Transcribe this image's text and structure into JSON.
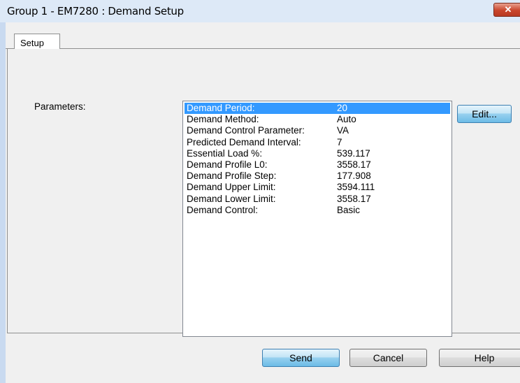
{
  "window": {
    "title": "Group 1 - EM7280 : Demand Setup",
    "close_label": "✕"
  },
  "tabs": [
    {
      "label": "Setup"
    }
  ],
  "parameters": {
    "label": "Parameters:",
    "rows": [
      {
        "key": "Demand Period:",
        "value": "20"
      },
      {
        "key": "Demand Method:",
        "value": "Auto"
      },
      {
        "key": "Demand Control Parameter:",
        "value": "VA"
      },
      {
        "key": "Predicted Demand Interval:",
        "value": "7"
      },
      {
        "key": "Essential Load %:",
        "value": "539.117"
      },
      {
        "key": "Demand Profile L0:",
        "value": "3558.17"
      },
      {
        "key": "Demand Profile Step:",
        "value": "177.908"
      },
      {
        "key": "Demand Upper Limit:",
        "value": "3594.111"
      },
      {
        "key": "Demand Lower Limit:",
        "value": "3558.17"
      },
      {
        "key": "Demand Control:",
        "value": "Basic"
      }
    ],
    "edit_label": "Edit..."
  },
  "footer": {
    "send_label": "Send",
    "cancel_label": "Cancel",
    "help_label": "Help"
  }
}
